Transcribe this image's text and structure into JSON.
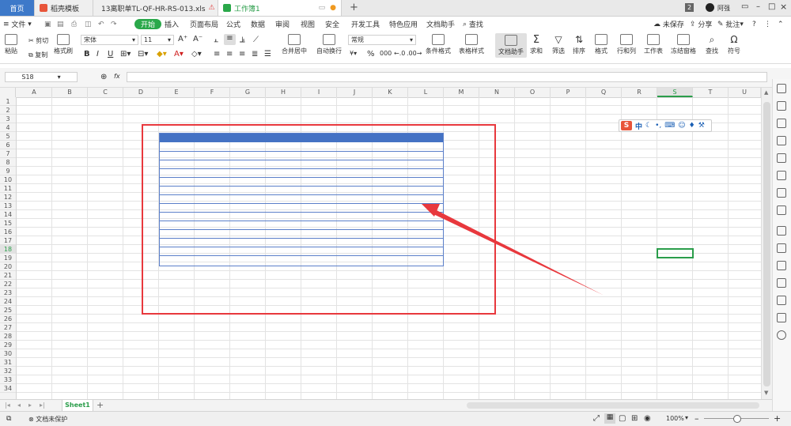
{
  "tabs": [
    {
      "label": "首页"
    },
    {
      "label": "稻壳模板"
    },
    {
      "label": "13离职单TL-QF-HR-RS-013.xls"
    },
    {
      "label": "工作簿1"
    }
  ],
  "topright": {
    "badge": "2",
    "user": "阿强"
  },
  "menu": [
    "文件",
    "开始",
    "插入",
    "页面布局",
    "公式",
    "数据",
    "审阅",
    "视图",
    "安全",
    "开发工具",
    "特色应用",
    "文档助手"
  ],
  "search": "查找",
  "menu_right": {
    "unsaved": "未保存",
    "share": "分享",
    "comment": "批注"
  },
  "toolbar": {
    "paste": "粘贴",
    "cut": "剪切",
    "copy": "复制",
    "format_painter": "格式刷",
    "font_name": "宋体",
    "font_size": "11",
    "merge_center": "合并居中",
    "wrap": "自动换行",
    "number_format": "常规",
    "cond_format": "条件格式",
    "table_style": "表格样式",
    "doc_helper": "文档助手",
    "sum": "求和",
    "filter": "筛选",
    "sort": "排序",
    "format": "格式",
    "row_col": "行和列",
    "worksheet": "工作表",
    "freeze": "冻结窗格",
    "find": "查找",
    "symbol": "符号"
  },
  "formula_bar": {
    "cell_ref": "S18",
    "fx": "fx",
    "content": ""
  },
  "columns": [
    "A",
    "B",
    "C",
    "D",
    "E",
    "F",
    "G",
    "H",
    "I",
    "J",
    "K",
    "L",
    "M",
    "N",
    "O",
    "P",
    "Q",
    "R",
    "S",
    "T",
    "U"
  ],
  "rows": [
    "1",
    "2",
    "3",
    "4",
    "5",
    "6",
    "7",
    "8",
    "9",
    "10",
    "11",
    "12",
    "13",
    "14",
    "15",
    "16",
    "17",
    "18",
    "19",
    "20",
    "21",
    "22",
    "23",
    "24",
    "25",
    "26",
    "27",
    "28",
    "29",
    "30",
    "31",
    "32",
    "33",
    "34"
  ],
  "selected": {
    "column": "S",
    "row": "18"
  },
  "ime": {
    "label": "中"
  },
  "sheets": [
    {
      "name": "Sheet1"
    }
  ],
  "status": {
    "protect": "文档未保护",
    "zoom": "100%"
  },
  "colors": {
    "accent": "#2aa84a",
    "header_band": "#4472c4",
    "table_border": "#5b7fc9",
    "annotation": "#e8383d"
  }
}
